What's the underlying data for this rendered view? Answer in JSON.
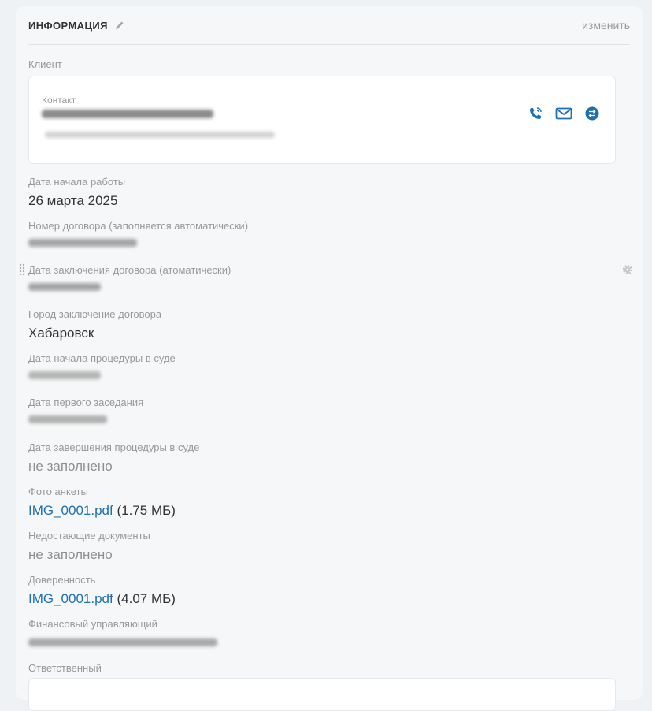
{
  "header": {
    "title": "ИНФОРМАЦИЯ",
    "edit_label": "изменить"
  },
  "client": {
    "label": "Клиент",
    "contact_label": "Контакт",
    "icons": [
      "phone-icon",
      "mail-icon",
      "chat-icon"
    ]
  },
  "fields": {
    "start_date": {
      "label": "Дата начала работы",
      "value": "26 марта 2025"
    },
    "contract_number": {
      "label": "Номер договора (заполняется автоматически)"
    },
    "contract_date": {
      "label": "Дата заключения договора (атоматически)"
    },
    "contract_city": {
      "label": "Город заключение договора",
      "value": "Хабаровск"
    },
    "court_start": {
      "label": "Дата начала процедуры в суде"
    },
    "first_hearing": {
      "label": "Дата первого заседания"
    },
    "court_end": {
      "label": "Дата завершения процедуры в суде",
      "value": "не заполнено"
    },
    "photo": {
      "label": "Фото анкеты",
      "file": "IMG_0001.pdf",
      "size": "(1.75 МБ)"
    },
    "missing_docs": {
      "label": "Недостающие документы",
      "value": "не заполнено"
    },
    "power_of_attorney": {
      "label": "Доверенность",
      "file": "IMG_0001.pdf",
      "size": "(4.07 МБ)"
    },
    "financial_manager": {
      "label": "Финансовый управляющий"
    },
    "responsible": {
      "label": "Ответственный"
    }
  },
  "colors": {
    "accent": "#1f70b0",
    "muted": "#999999",
    "background": "#f5f7f8"
  }
}
